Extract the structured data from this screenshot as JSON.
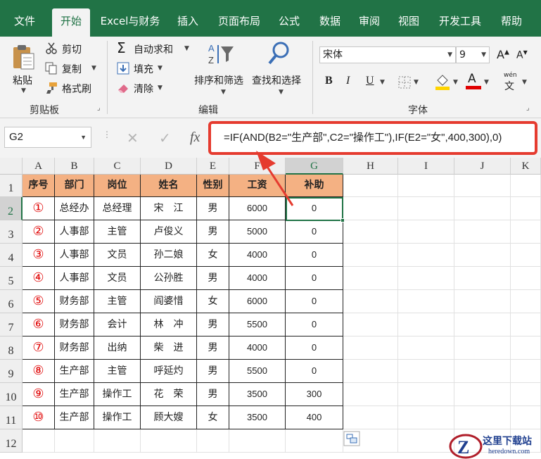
{
  "tabs": [
    "文件",
    "开始",
    "Excel与财务",
    "插入",
    "页面布局",
    "公式",
    "数据",
    "审阅",
    "视图",
    "开发工具",
    "帮助"
  ],
  "active_tab": "开始",
  "ribbon": {
    "clipboard": {
      "paste": "粘贴",
      "cut": "剪切",
      "copy": "复制",
      "format_painter": "格式刷",
      "group": "剪贴板"
    },
    "editing": {
      "autosum": "自动求和",
      "fill": "填充",
      "clear": "清除",
      "sort_filter": "排序和筛选",
      "find_select": "查找和选择",
      "group": "编辑"
    },
    "font": {
      "font_name": "宋体",
      "font_size": "9",
      "bold": "B",
      "italic": "I",
      "underline": "U",
      "grow": "A",
      "shrink": "A",
      "phonetic": "wén",
      "group": "字体"
    }
  },
  "formula_bar": {
    "name_box": "G2",
    "fx": "fx",
    "formula": "=IF(AND(B2=\"生产部\",C2=\"操作工\"),IF(E2=\"女\",400,300),0)"
  },
  "colors": {
    "brand": "#217346",
    "header_fill": "#f4b183",
    "highlight": "#e53b2f"
  },
  "columns": [
    "A",
    "B",
    "C",
    "D",
    "E",
    "F",
    "G",
    "H",
    "I",
    "J",
    "K"
  ],
  "rows": [
    "1",
    "2",
    "3",
    "4",
    "5",
    "6",
    "7",
    "8",
    "9",
    "10",
    "11",
    "12"
  ],
  "table": {
    "headers": [
      "序号",
      "部门",
      "岗位",
      "姓名",
      "性别",
      "工资",
      "补助"
    ],
    "data": [
      [
        "①",
        "总经办",
        "总经理",
        "宋　江",
        "男",
        "6000",
        "0"
      ],
      [
        "②",
        "人事部",
        "主管",
        "卢俊义",
        "男",
        "5000",
        "0"
      ],
      [
        "③",
        "人事部",
        "文员",
        "孙二娘",
        "女",
        "4000",
        "0"
      ],
      [
        "④",
        "人事部",
        "文员",
        "公孙胜",
        "男",
        "4000",
        "0"
      ],
      [
        "⑤",
        "财务部",
        "主管",
        "阎婆惜",
        "女",
        "6000",
        "0"
      ],
      [
        "⑥",
        "财务部",
        "会计",
        "林　冲",
        "男",
        "5500",
        "0"
      ],
      [
        "⑦",
        "财务部",
        "出纳",
        "柴　进",
        "男",
        "4000",
        "0"
      ],
      [
        "⑧",
        "生产部",
        "主管",
        "呼延灼",
        "男",
        "5500",
        "0"
      ],
      [
        "⑨",
        "生产部",
        "操作工",
        "花　荣",
        "男",
        "3500",
        "300"
      ],
      [
        "⑩",
        "生产部",
        "操作工",
        "顾大嫂",
        "女",
        "3500",
        "400"
      ]
    ]
  },
  "watermark": {
    "site": "这里下载站",
    "url": "heredown.com"
  }
}
